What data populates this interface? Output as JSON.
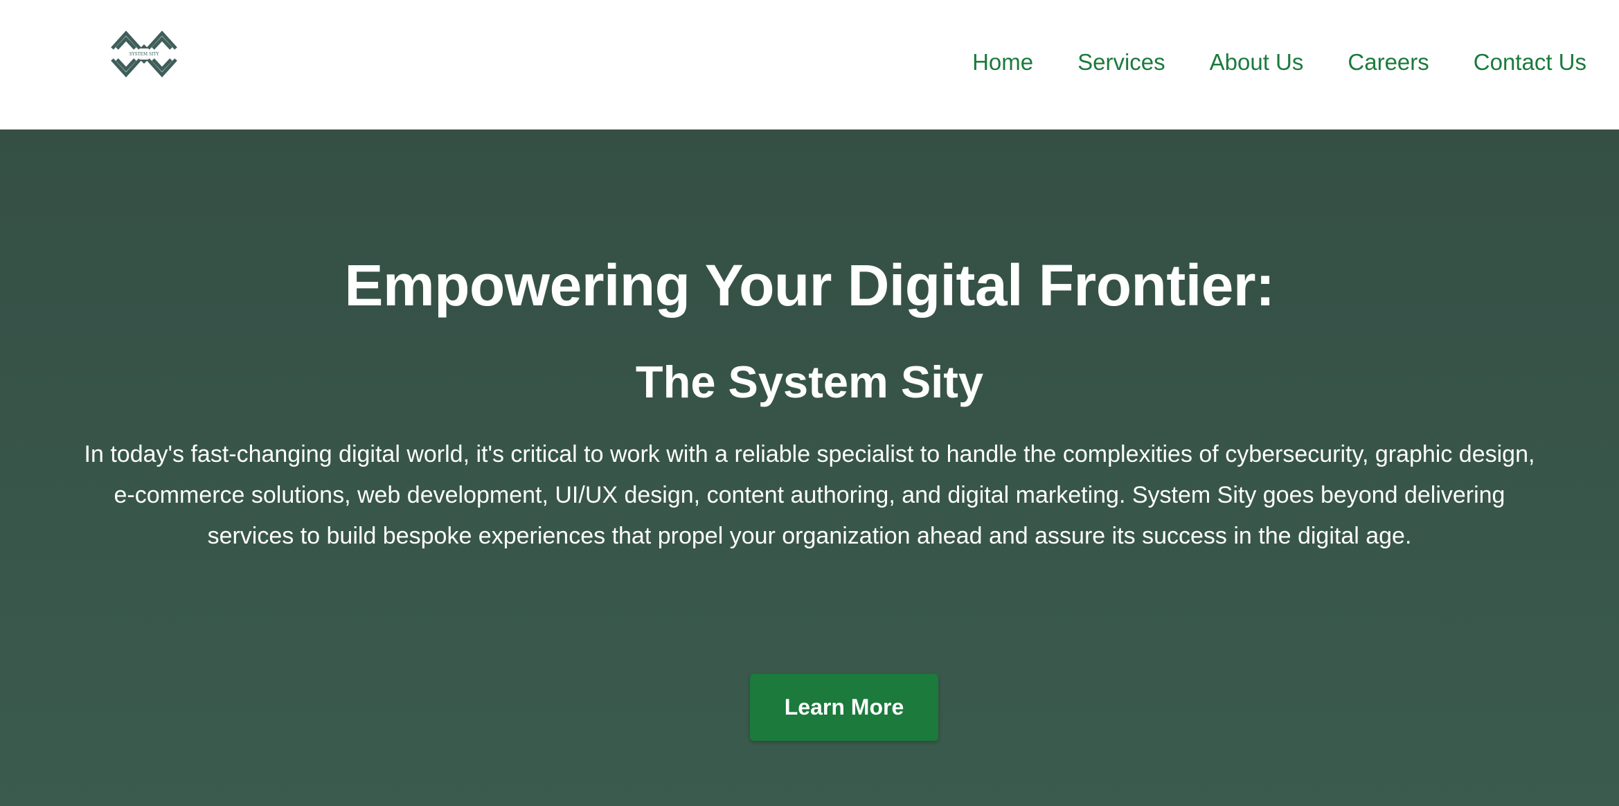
{
  "brand": {
    "logo_icon": "system-sity-logo-icon",
    "logo_text": "SYSTEM SITY",
    "logo_color": "#3f5e5a"
  },
  "nav": {
    "items": [
      {
        "label": "Home"
      },
      {
        "label": "Services"
      },
      {
        "label": "About Us"
      },
      {
        "label": "Careers"
      },
      {
        "label": "Contact Us"
      }
    ],
    "color": "#1b7a3c"
  },
  "hero": {
    "title": "Empowering Your Digital Frontier:",
    "subtitle": "The System Sity",
    "description": "In today's fast-changing digital world, it's critical to work with a reliable specialist to handle the complexities of cybersecurity, graphic design, e-commerce solutions, web development, UI/UX design, content authoring, and digital marketing. System Sity goes beyond delivering services to build bespoke experiences that propel your organization ahead and assure its success in the digital age.",
    "cta_label": "Learn More",
    "background_color": "#354f45",
    "cta_color": "#1b7a3c"
  }
}
